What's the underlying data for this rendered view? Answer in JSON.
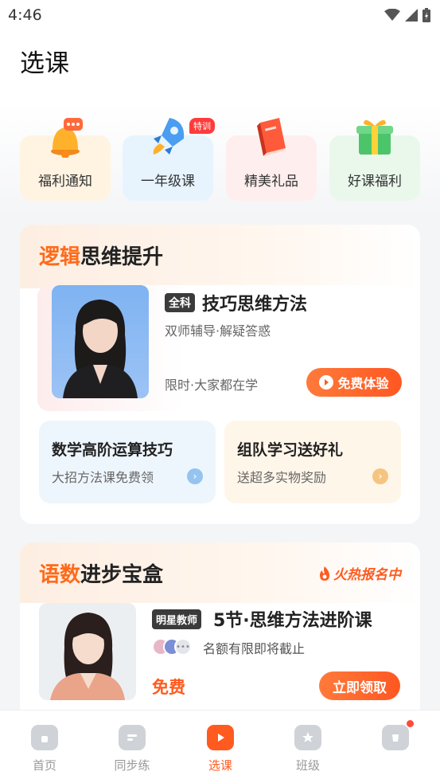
{
  "status": {
    "time": "4:46"
  },
  "header": {
    "title": "选课"
  },
  "quick_links": [
    {
      "label": "福利通知",
      "icon": "bell-icon",
      "bg": "#fff3e2"
    },
    {
      "label": "一年级课",
      "icon": "rocket-icon",
      "bg": "#e7f4fd",
      "badge": "特训"
    },
    {
      "label": "精美礼品",
      "icon": "book-icon",
      "bg": "#ffeeee"
    },
    {
      "label": "好课福利",
      "icon": "gift-icon",
      "bg": "#eaf8ec"
    }
  ],
  "logic_section": {
    "title_accent": "逻辑",
    "title_rest": "思维提升",
    "featured": {
      "subject_badge": "全科",
      "title": "技巧思维方法",
      "subtitle": "双师辅导·解疑答惑",
      "note": "限时·大家都在学",
      "button": "免费体验"
    },
    "sub_cards": [
      {
        "title": "数学高阶运算技巧",
        "desc": "大招方法课免费领",
        "bg": "#eef6fd",
        "arrow_color": "#5aa3e6"
      },
      {
        "title": "组队学习送好礼",
        "desc": "送超多实物奖励",
        "bg": "#fff6ea",
        "arrow_color": "#f0a43c"
      }
    ]
  },
  "box_section": {
    "title_accent": "语数",
    "title_rest": "进步宝盒",
    "hot_tag": "火热报名中",
    "course": {
      "badge": "明星教师",
      "title": "5节·思维方法进阶课",
      "limited": "名额有限即将截止",
      "price": "免费",
      "button": "立即领取"
    }
  },
  "tabbar": {
    "items": [
      {
        "label": "首页",
        "icon": "home-icon"
      },
      {
        "label": "同步练",
        "icon": "practice-icon"
      },
      {
        "label": "选课",
        "icon": "play-icon",
        "active": true
      },
      {
        "label": "班级",
        "icon": "class-icon"
      },
      {
        "label": "",
        "icon": "profile-icon",
        "dot": true
      }
    ]
  },
  "colors": {
    "accent": "#ff5a1f",
    "text": "#222222",
    "muted": "#666666"
  }
}
